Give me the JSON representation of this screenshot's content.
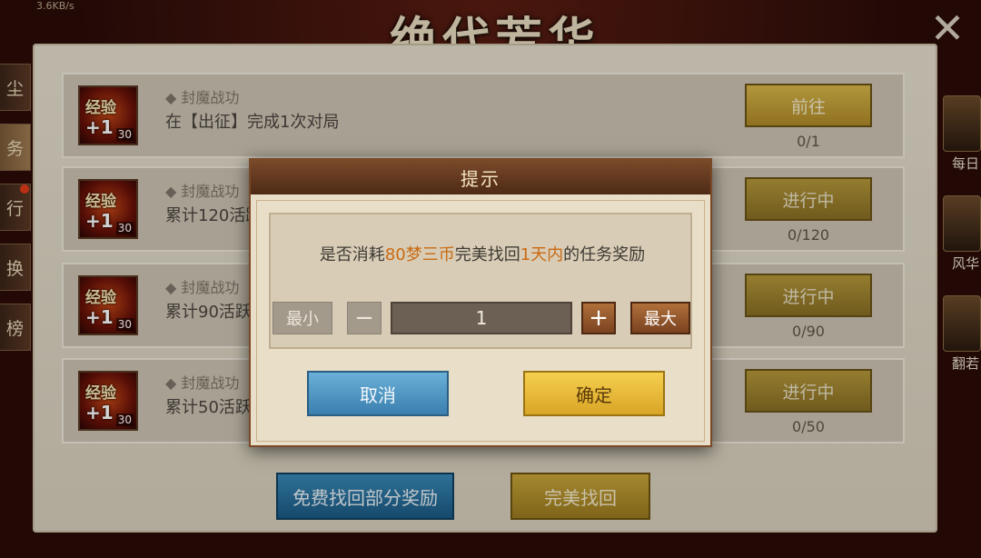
{
  "title_art": "绝代芳华",
  "top_status": "3.6KB/s",
  "left_tabs": [
    "尘",
    "务",
    "行",
    "换",
    "榜"
  ],
  "right_side": [
    {
      "label": "每日",
      "icon": "exp-reward-icon"
    },
    {
      "label": "风华",
      "icon": "character-icon"
    },
    {
      "label": "翻若",
      "icon": "avatar-icon"
    }
  ],
  "tasks": [
    {
      "category": "◆ 封魔战功",
      "desc": "在【出征】完成1次对局",
      "button": "前往",
      "progress": "0/1",
      "reward_label": "经验",
      "reward_plus": "+1",
      "reward_count": "30"
    },
    {
      "category": "◆ 封魔战功",
      "desc": "累计120活跃",
      "button": "进行中",
      "progress": "0/120",
      "reward_label": "经验",
      "reward_plus": "+1",
      "reward_count": "30"
    },
    {
      "category": "◆ 封魔战功",
      "desc": "累计90活跃",
      "button": "进行中",
      "progress": "0/90",
      "reward_label": "经验",
      "reward_plus": "+1",
      "reward_count": "30"
    },
    {
      "category": "◆ 封魔战功",
      "desc": "累计50活跃",
      "button": "进行中",
      "progress": "0/50",
      "reward_label": "经验",
      "reward_plus": "+1",
      "reward_count": "30"
    }
  ],
  "bottom": {
    "free_label": "免费找回部分奖励",
    "perfect_label": "完美找回"
  },
  "dialog": {
    "title": "提示",
    "msg_part1": "是否消耗",
    "msg_cost": "80梦三币",
    "msg_part2": "完美找回",
    "msg_days": "1天内",
    "msg_part3": "的任务奖励",
    "min_label": "最小",
    "minus_label": "−",
    "quantity": "1",
    "plus_label": "+",
    "max_label": "最大",
    "cancel_label": "取消",
    "ok_label": "确定"
  },
  "colors": {
    "highlight": "#c96a12",
    "cancel": "#3a7fae",
    "ok": "#d9a526",
    "go": "#b08a28"
  }
}
